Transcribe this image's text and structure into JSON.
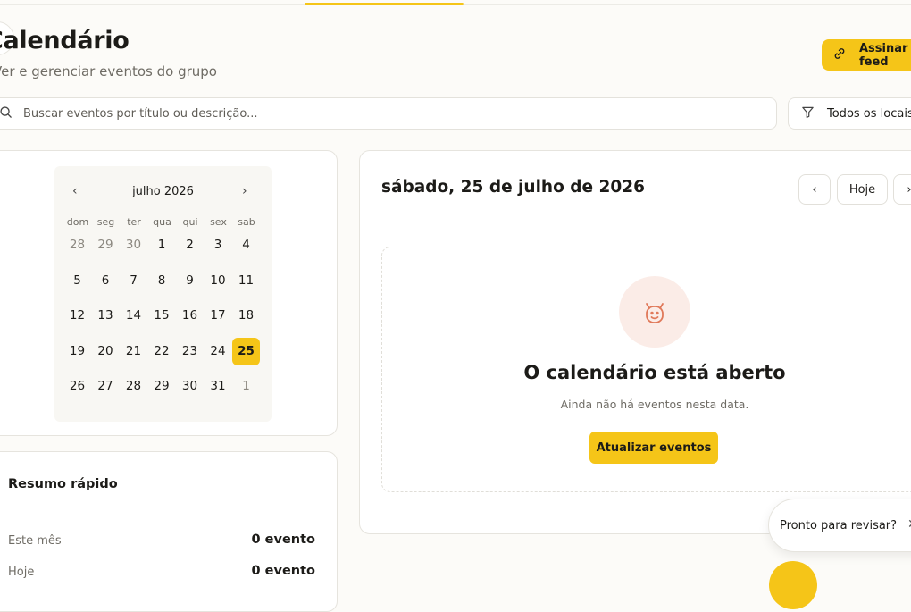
{
  "header": {
    "title": "Calendário",
    "subtitle": "Ver e gerenciar eventos do grupo",
    "subscribe_label": "Assinar feed"
  },
  "toolbar": {
    "search_placeholder": "Buscar eventos por título ou descrição...",
    "filter_label": "Todos os locais"
  },
  "calendar": {
    "month_label": "julho 2026",
    "weekdays": [
      "dom",
      "seg",
      "ter",
      "qua",
      "qui",
      "sex",
      "sab"
    ],
    "days": [
      [
        "28",
        "29",
        "30",
        "1",
        "2",
        "3",
        "4"
      ],
      [
        "5",
        "6",
        "7",
        "8",
        "9",
        "10",
        "11"
      ],
      [
        "12",
        "13",
        "14",
        "15",
        "16",
        "17",
        "18"
      ],
      [
        "19",
        "20",
        "21",
        "22",
        "23",
        "24",
        "25"
      ],
      [
        "26",
        "27",
        "28",
        "29",
        "30",
        "31",
        "1"
      ]
    ],
    "selected": "25"
  },
  "summary": {
    "title": "Resumo rápido",
    "rows": [
      {
        "label": "Este mês",
        "value": "0 evento"
      },
      {
        "label": "Hoje",
        "value": "0 evento"
      }
    ]
  },
  "day_view": {
    "date_title": "sábado, 25 de julho de 2026",
    "today_label": "Hoje",
    "empty_title": "O calendário está aberto",
    "empty_text": "Ainda não há eventos nesta data.",
    "refresh_label": "Atualizar eventos"
  },
  "toast": {
    "text": "Pronto para revisar?"
  },
  "colors": {
    "accent": "#f5c518",
    "icon_bg": "#fbece7",
    "icon_stroke": "#e0795a"
  }
}
